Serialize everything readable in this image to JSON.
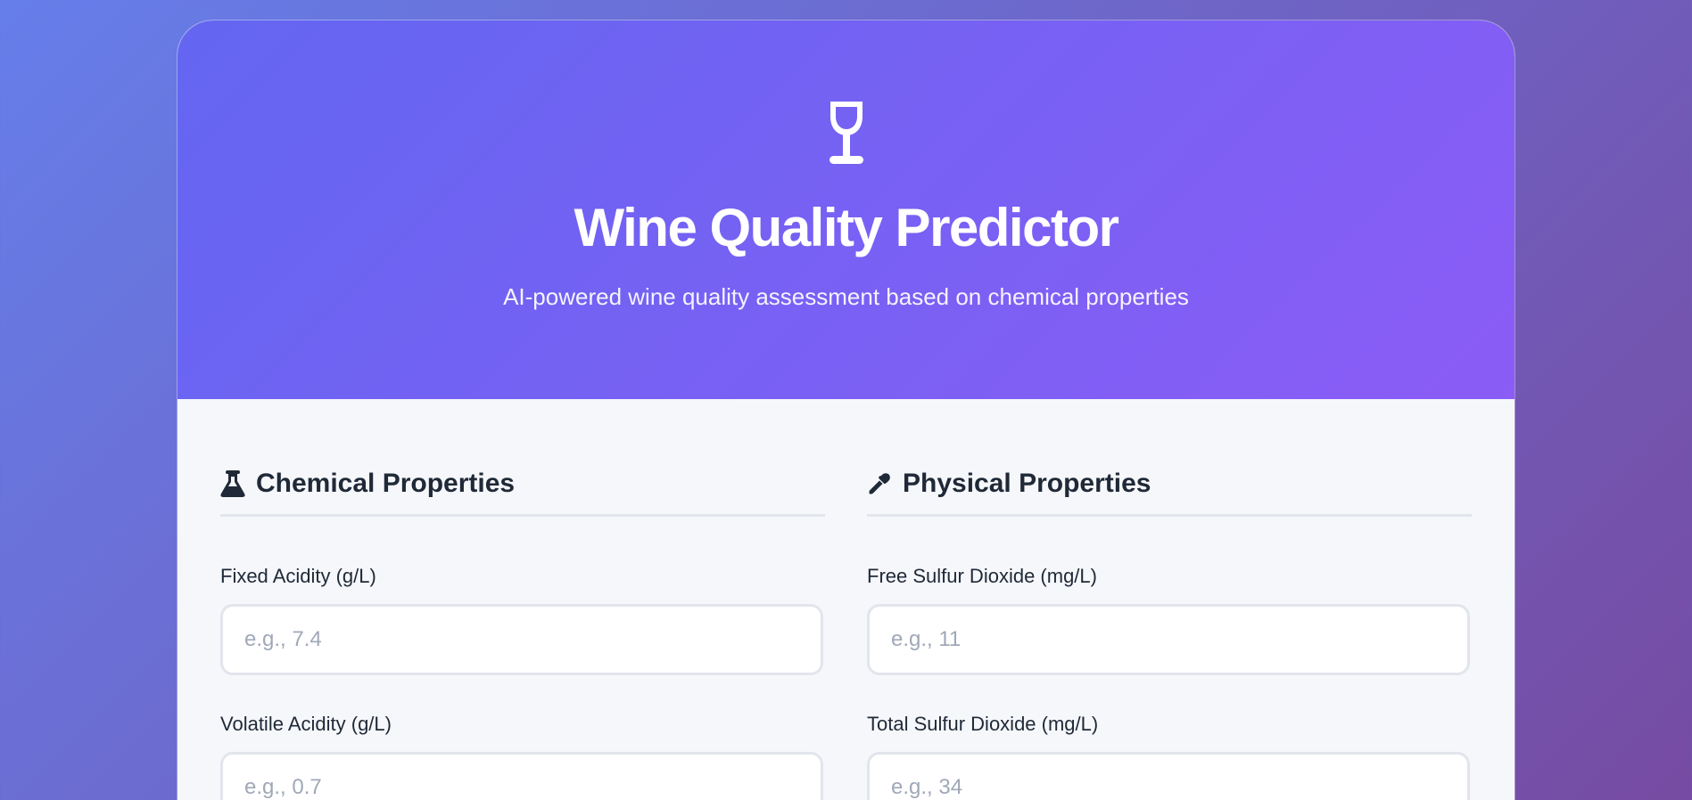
{
  "header": {
    "icon": "wine-glass-icon",
    "title": "Wine Quality Predictor",
    "subtitle": "AI-powered wine quality assessment based on chemical properties"
  },
  "colors": {
    "page_gradient_start": "#667eea",
    "page_gradient_end": "#764ba2",
    "hero_gradient_start": "#6366f1",
    "hero_gradient_end": "#8b5cf6",
    "heading_text": "#1f2937"
  },
  "sections": {
    "chemical": {
      "icon": "flask-icon",
      "title": "Chemical Properties",
      "fields": [
        {
          "label": "Fixed Acidity (g/L)",
          "value": "",
          "placeholder": "e.g., 7.4"
        },
        {
          "label": "Volatile Acidity (g/L)",
          "value": "",
          "placeholder": "e.g., 0.7"
        }
      ]
    },
    "physical": {
      "icon": "eyedropper-icon",
      "title": "Physical Properties",
      "fields": [
        {
          "label": "Free Sulfur Dioxide (mg/L)",
          "value": "",
          "placeholder": "e.g., 11"
        },
        {
          "label": "Total Sulfur Dioxide (mg/L)",
          "value": "",
          "placeholder": "e.g., 34"
        }
      ]
    }
  }
}
